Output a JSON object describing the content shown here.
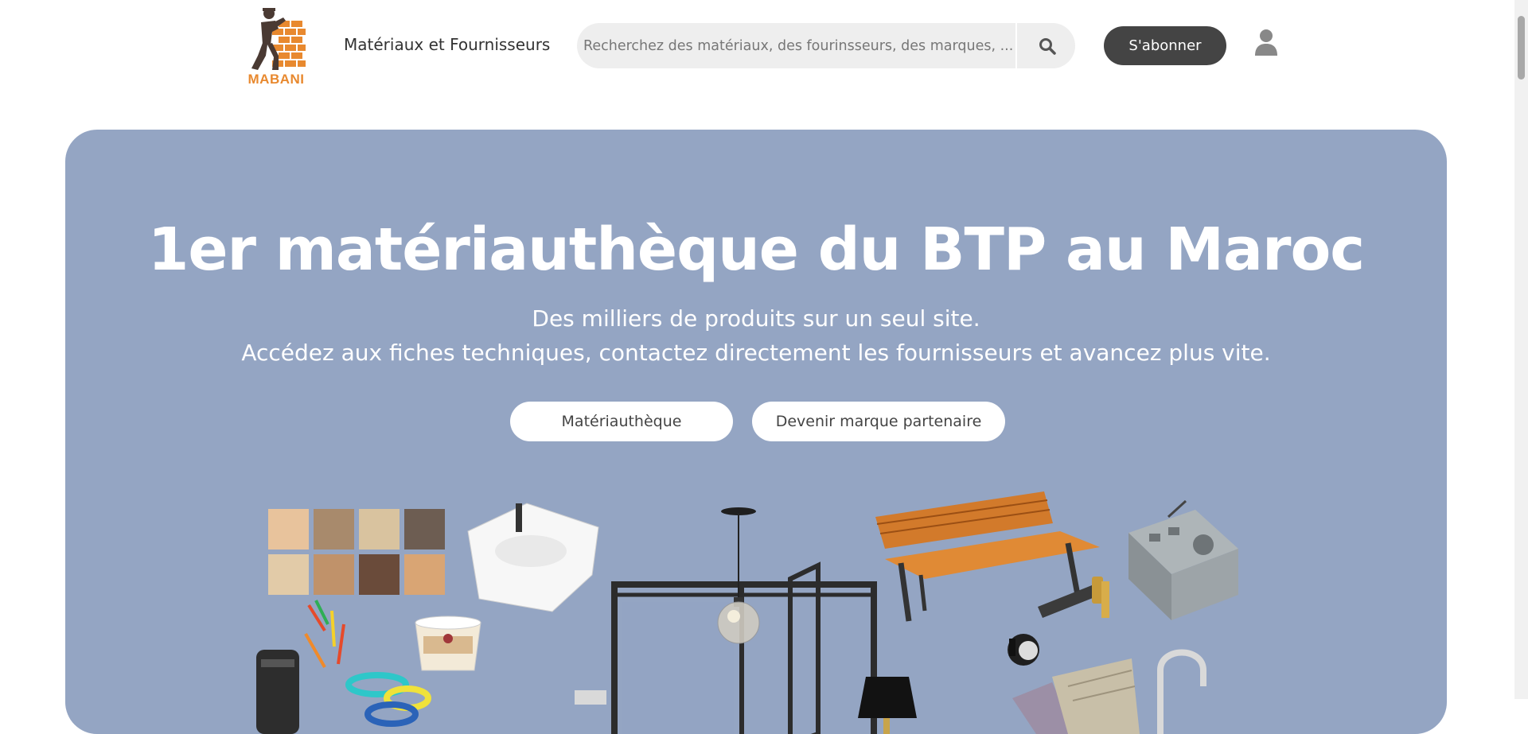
{
  "header": {
    "logo_text": "MABANI",
    "nav_link": "Matériaux et Fournisseurs",
    "search_placeholder": "Recherchez des matériaux, des fourinsseurs, des marques, ...",
    "search_icon": "magnifier-icon",
    "subscribe_label": "S'abonner",
    "account_icon": "user-icon"
  },
  "hero": {
    "title": "1er matériauthèque du BTP au Maroc",
    "subtitle_line1": "Des milliers de produits sur un seul site.",
    "subtitle_line2": "Accédez aux fiches techniques, contactez directement les fournisseurs et avancez plus vite.",
    "button_primary": "Matériauthèque",
    "button_secondary": "Devenir marque partenaire",
    "background_color": "#94a5c3"
  },
  "colors": {
    "brand_orange": "#e8892f",
    "subscribe_bg": "#444444",
    "search_bg": "#eeeeee"
  }
}
